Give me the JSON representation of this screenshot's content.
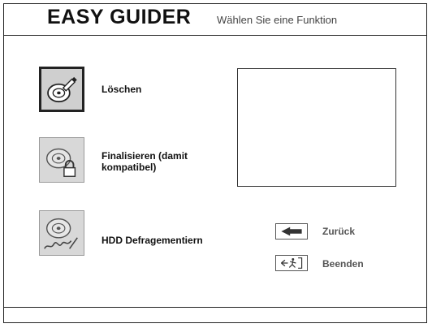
{
  "header": {
    "title": "EASY GUIDER",
    "subtitle": "Wählen Sie eine Funktion"
  },
  "functions": [
    {
      "label": "Löschen",
      "icon": "disc-erase-icon",
      "selected": true
    },
    {
      "label_line1": "Finalisieren (damit",
      "label_line2": "kompatibel)",
      "icon": "disc-lock-icon",
      "selected": false
    },
    {
      "label": "HDD Defragementiern",
      "icon": "disc-defrag-icon",
      "selected": false
    }
  ],
  "navigation": {
    "back_label": "Zurück",
    "exit_label": "Beenden"
  },
  "colors": {
    "button_bg": "#d8d8d8",
    "border": "#222222",
    "muted_text": "#555555"
  }
}
